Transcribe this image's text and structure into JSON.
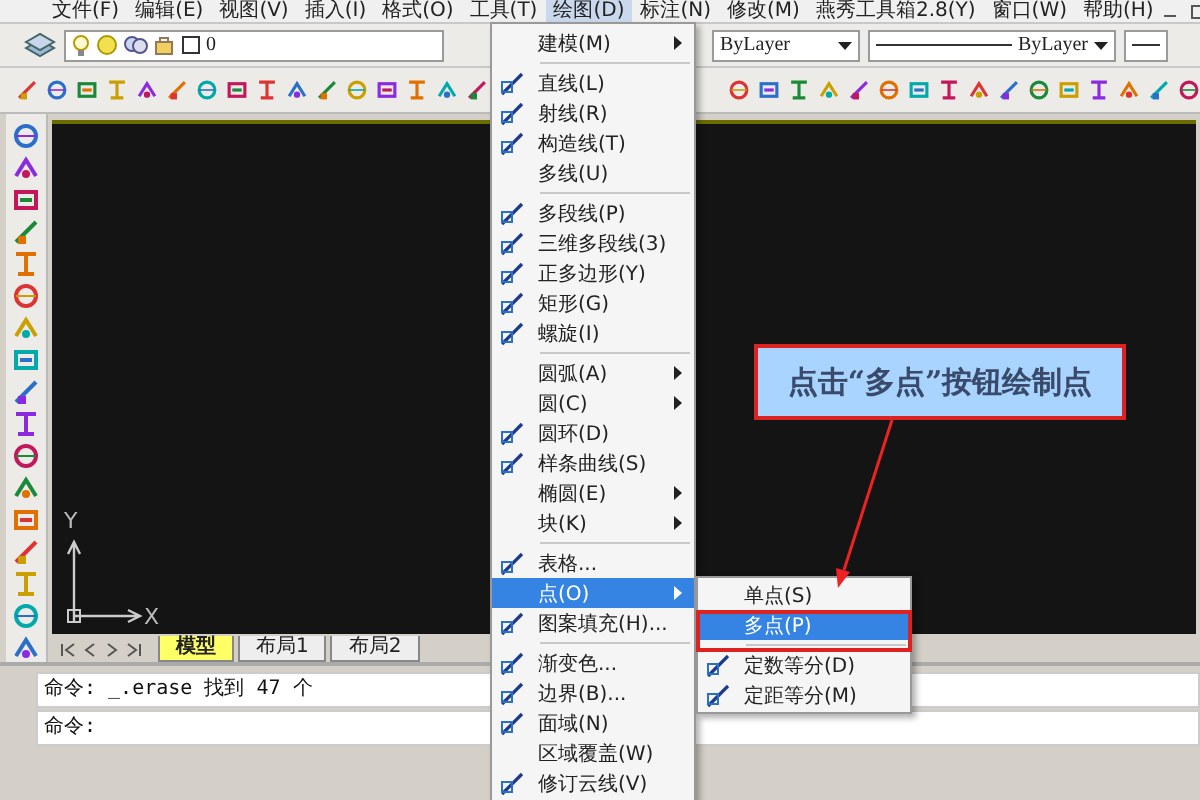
{
  "menubar": {
    "items": [
      {
        "label": "文件(F)",
        "selected": false
      },
      {
        "label": "编辑(E)",
        "selected": false
      },
      {
        "label": "视图(V)",
        "selected": false
      },
      {
        "label": "插入(I)",
        "selected": false
      },
      {
        "label": "格式(O)",
        "selected": false
      },
      {
        "label": "工具(T)",
        "selected": false
      },
      {
        "label": "绘图(D)",
        "selected": true
      },
      {
        "label": "标注(N)",
        "selected": false
      },
      {
        "label": "修改(M)",
        "selected": false
      },
      {
        "label": "燕秀工具箱2.8(Y)",
        "selected": false
      },
      {
        "label": "窗口(W)",
        "selected": false
      },
      {
        "label": "帮助(H)",
        "selected": false
      }
    ]
  },
  "layer_toolbar": {
    "layer": "0",
    "color_combo": "ByLayer",
    "linetype_combo": "ByLayer"
  },
  "draw_menu": {
    "items": [
      {
        "kind": "plain",
        "label": "建模(M)",
        "submenu": true,
        "selected": false
      },
      {
        "kind": "separator"
      },
      {
        "kind": "with-icon",
        "label": "直线(L)",
        "submenu": false,
        "selected": false
      },
      {
        "kind": "with-icon",
        "label": "射线(R)",
        "submenu": false,
        "selected": false
      },
      {
        "kind": "with-icon",
        "label": "构造线(T)",
        "submenu": false,
        "selected": false
      },
      {
        "kind": "plain",
        "label": "多线(U)",
        "submenu": false,
        "selected": false
      },
      {
        "kind": "separator"
      },
      {
        "kind": "with-icon",
        "label": "多段线(P)",
        "submenu": false,
        "selected": false
      },
      {
        "kind": "with-icon",
        "label": "三维多段线(3)",
        "submenu": false,
        "selected": false
      },
      {
        "kind": "with-icon",
        "label": "正多边形(Y)",
        "submenu": false,
        "selected": false
      },
      {
        "kind": "with-icon",
        "label": "矩形(G)",
        "submenu": false,
        "selected": false
      },
      {
        "kind": "with-icon",
        "label": "螺旋(I)",
        "submenu": false,
        "selected": false
      },
      {
        "kind": "separator"
      },
      {
        "kind": "plain",
        "label": "圆弧(A)",
        "submenu": true,
        "selected": false
      },
      {
        "kind": "plain",
        "label": "圆(C)",
        "submenu": true,
        "selected": false
      },
      {
        "kind": "with-icon",
        "label": "圆环(D)",
        "submenu": false,
        "selected": false
      },
      {
        "kind": "with-icon",
        "label": "样条曲线(S)",
        "submenu": false,
        "selected": false
      },
      {
        "kind": "plain",
        "label": "椭圆(E)",
        "submenu": true,
        "selected": false
      },
      {
        "kind": "plain",
        "label": "块(K)",
        "submenu": true,
        "selected": false
      },
      {
        "kind": "separator"
      },
      {
        "kind": "with-icon",
        "label": "表格...",
        "submenu": false,
        "selected": false
      },
      {
        "kind": "plain",
        "label": "点(O)",
        "submenu": true,
        "selected": true
      },
      {
        "kind": "with-icon",
        "label": "图案填充(H)...",
        "submenu": false,
        "selected": false
      },
      {
        "kind": "separator"
      },
      {
        "kind": "with-icon",
        "label": "渐变色...",
        "submenu": false,
        "selected": false
      },
      {
        "kind": "with-icon",
        "label": "边界(B)...",
        "submenu": false,
        "selected": false
      },
      {
        "kind": "with-icon",
        "label": "面域(N)",
        "submenu": false,
        "selected": false
      },
      {
        "kind": "plain",
        "label": "区域覆盖(W)",
        "submenu": false,
        "selected": false
      },
      {
        "kind": "with-icon",
        "label": "修订云线(V)",
        "submenu": false,
        "selected": false
      }
    ]
  },
  "point_submenu": {
    "items": [
      {
        "kind": "plain",
        "label": "单点(S)",
        "selected": false
      },
      {
        "kind": "plain",
        "label": "多点(P)",
        "selected": true
      },
      {
        "kind": "separator"
      },
      {
        "kind": "with-icon",
        "label": "定数等分(D)",
        "selected": false
      },
      {
        "kind": "with-icon",
        "label": "定距等分(M)",
        "selected": false
      }
    ]
  },
  "canvas": {
    "y_label": "Y",
    "x_label": "X",
    "callout": "点击“多点”按钮绘制点"
  },
  "layout_tabs": [
    {
      "label": "模型",
      "selected": true
    },
    {
      "label": "布局1",
      "selected": false
    },
    {
      "label": "布局2",
      "selected": false
    }
  ],
  "command_lines": [
    "命令: _.erase 找到 47 个",
    "命令:"
  ]
}
